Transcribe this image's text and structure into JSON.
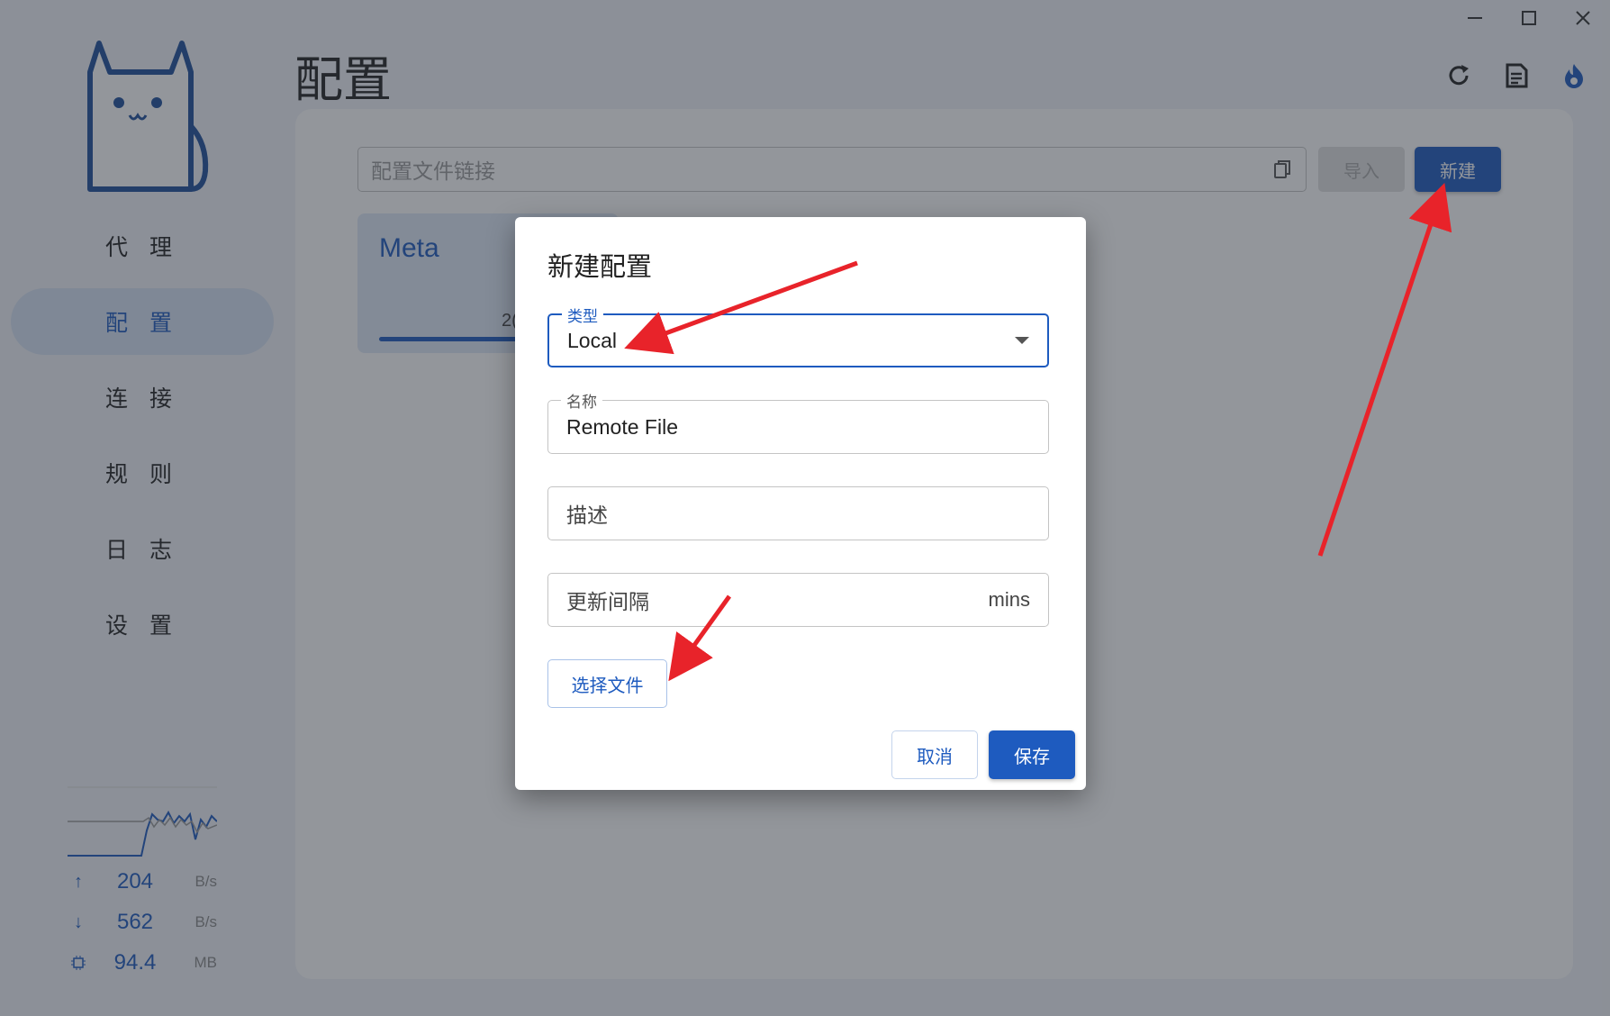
{
  "window": {
    "controls": [
      "minimize-icon",
      "maximize-icon",
      "close-icon"
    ]
  },
  "sidebar": {
    "logo": "cat-logo",
    "items": [
      {
        "label": "代 理",
        "active": false
      },
      {
        "label": "配 置",
        "active": true
      },
      {
        "label": "连 接",
        "active": false
      },
      {
        "label": "规 则",
        "active": false
      },
      {
        "label": "日 志",
        "active": false
      },
      {
        "label": "设 置",
        "active": false
      }
    ],
    "traffic": {
      "upload": {
        "value": "204",
        "unit": "B/s"
      },
      "download": {
        "value": "562",
        "unit": "B/s"
      },
      "memory": {
        "value": "94.4",
        "unit": "MB"
      }
    }
  },
  "header": {
    "title": "配置",
    "tools": [
      "refresh-icon",
      "document-icon",
      "fire-icon"
    ]
  },
  "toolbar": {
    "url_placeholder": "配置文件链接",
    "import_label": "导入",
    "new_label": "新建"
  },
  "profile": {
    "name": "Meta",
    "date_fragment": "2("
  },
  "dialog": {
    "title": "新建配置",
    "type": {
      "label": "类型",
      "value": "Local"
    },
    "name": {
      "label": "名称",
      "value": "Remote File"
    },
    "desc": {
      "placeholder": "描述"
    },
    "interval": {
      "placeholder": "更新间隔",
      "suffix": "mins"
    },
    "choose_file_label": "选择文件",
    "cancel_label": "取消",
    "save_label": "保存"
  },
  "colors": {
    "accent": "#1e5bbf",
    "annotation": "#e8232a"
  }
}
